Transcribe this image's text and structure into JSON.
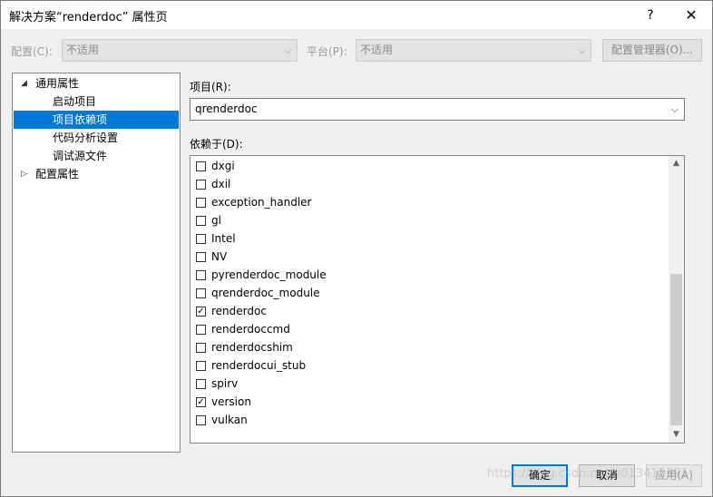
{
  "window": {
    "title": "解决方案“renderdoc” 属性页",
    "help_glyph": "?",
    "close_glyph": "✕"
  },
  "config_row": {
    "config_label": "配置(C):",
    "config_value": "不适用",
    "platform_label": "平台(P):",
    "platform_value": "不适用",
    "manager_button": "配置管理器(O)..."
  },
  "tree": {
    "items": [
      {
        "label": "通用属性",
        "expanded": true,
        "level": 0
      },
      {
        "label": "启动项目",
        "level": 1
      },
      {
        "label": "项目依赖项",
        "level": 1,
        "selected": true
      },
      {
        "label": "代码分析设置",
        "level": 1
      },
      {
        "label": "调试源文件",
        "level": 1
      },
      {
        "label": "配置属性",
        "expanded": false,
        "level": 0
      }
    ],
    "expanded_glyph": "◢",
    "collapsed_glyph": "▷"
  },
  "project": {
    "label": "项目(R):",
    "value": "qrenderdoc"
  },
  "depends": {
    "label": "依赖于(D):",
    "items": [
      {
        "name": "dxgi",
        "checked": false
      },
      {
        "name": "dxil",
        "checked": false
      },
      {
        "name": "exception_handler",
        "checked": false
      },
      {
        "name": "gl",
        "checked": false
      },
      {
        "name": "Intel",
        "checked": false
      },
      {
        "name": "NV",
        "checked": false
      },
      {
        "name": "pyrenderdoc_module",
        "checked": false
      },
      {
        "name": "qrenderdoc_module",
        "checked": false
      },
      {
        "name": "renderdoc",
        "checked": true
      },
      {
        "name": "renderdoccmd",
        "checked": false
      },
      {
        "name": "renderdocshim",
        "checked": false
      },
      {
        "name": "renderdocui_stub",
        "checked": false
      },
      {
        "name": "spirv",
        "checked": false
      },
      {
        "name": "version",
        "checked": true
      },
      {
        "name": "vulkan",
        "checked": false
      }
    ]
  },
  "buttons": {
    "ok": "确定",
    "cancel": "取消",
    "apply": "应用(A)"
  },
  "watermark": "https://blog.csdn.net/u013412391",
  "colors": {
    "selection": "#0078d7",
    "dialog_bg": "#f0f0f0"
  }
}
